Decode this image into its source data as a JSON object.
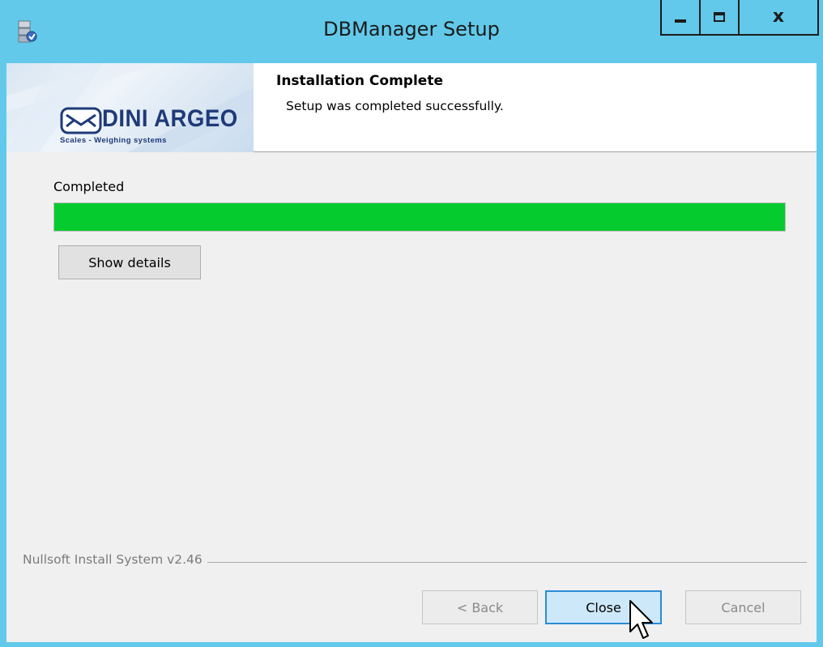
{
  "window": {
    "title": "DBManager Setup",
    "app_icon": "installer-icon",
    "caption_icons": [
      "minimize-icon",
      "maximize-icon",
      "close-icon"
    ]
  },
  "header": {
    "logo_text": "DINI ARGEO",
    "logo_subtitle": "Scales - Weighing systems",
    "title": "Installation Complete",
    "subtitle": "Setup was completed successfully."
  },
  "progress": {
    "label": "Completed",
    "percent": 100,
    "color": "#06cb2f"
  },
  "buttons": {
    "show_details": "Show details",
    "back": "< Back",
    "close": "Close",
    "cancel": "Cancel"
  },
  "branding": {
    "text": "Nullsoft Install System v2.46"
  },
  "colors": {
    "titlebar": "#62c9ea",
    "logo_blue": "#1f3a78",
    "default_button_border": "#2a8bd5"
  }
}
